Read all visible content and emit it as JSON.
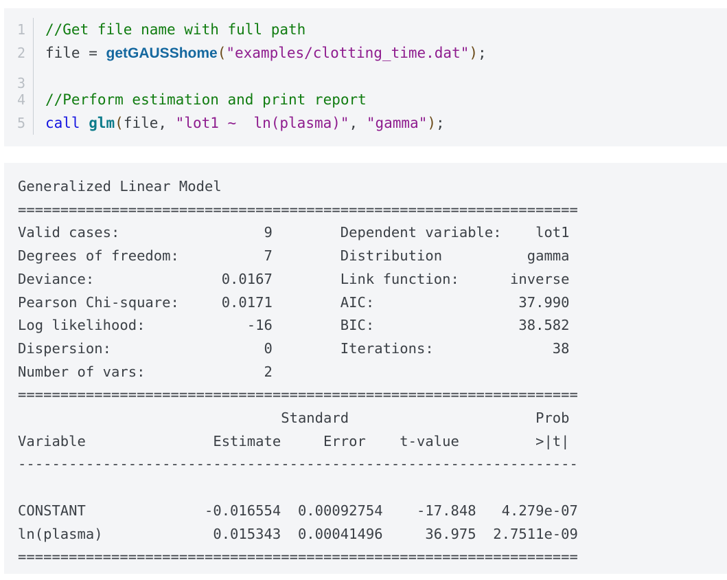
{
  "code_example": {
    "language": "GAUSS",
    "background_color": "#f4f5f7",
    "lines": [
      {
        "number": "1",
        "tokens": [
          {
            "text": "//Get file name with full path",
            "type": "comment"
          }
        ]
      },
      {
        "number": "2",
        "tokens": [
          {
            "text": "file = ",
            "type": "plain"
          },
          {
            "text": "getGAUSShome",
            "type": "fn-blue"
          },
          {
            "text": "(",
            "type": "punct"
          },
          {
            "text": "\"examples/clotting_time.dat\"",
            "type": "string"
          },
          {
            "text": ")",
            "type": "punct"
          },
          {
            "text": ";",
            "type": "plain"
          }
        ]
      },
      {
        "number": "3",
        "tokens": []
      },
      {
        "number": "4",
        "tokens": [
          {
            "text": "//Perform estimation and print report",
            "type": "comment"
          }
        ]
      },
      {
        "number": "5",
        "tokens": [
          {
            "text": "call ",
            "type": "keyword"
          },
          {
            "text": "glm",
            "type": "func-bold"
          },
          {
            "text": "(",
            "type": "punct"
          },
          {
            "text": "file, ",
            "type": "plain"
          },
          {
            "text": "\"lot1 ~  ln(plasma)\"",
            "type": "string"
          },
          {
            "text": ", ",
            "type": "plain"
          },
          {
            "text": "\"gamma\"",
            "type": "string"
          },
          {
            "text": ")",
            "type": "punct"
          },
          {
            "text": ";",
            "type": "plain"
          }
        ]
      }
    ]
  },
  "output": {
    "background_color": "#f4f5f7",
    "title": "Generalized Linear Model",
    "rule_double": "==================================================================",
    "rule_single": "------------------------------------------------------------------",
    "summary": {
      "left": [
        {
          "label": "Valid cases:",
          "value": "9"
        },
        {
          "label": "Degrees of freedom:",
          "value": "7"
        },
        {
          "label": "Deviance:",
          "value": "0.0167"
        },
        {
          "label": "Pearson Chi-square:",
          "value": "0.0171"
        },
        {
          "label": "Log likelihood:",
          "value": "-16"
        },
        {
          "label": "Dispersion:",
          "value": "0"
        },
        {
          "label": "Number of vars:",
          "value": "2"
        }
      ],
      "right": [
        {
          "label": "Dependent variable:",
          "value": "lot1"
        },
        {
          "label": "Distribution",
          "value": "gamma"
        },
        {
          "label": "Link function:",
          "value": "inverse"
        },
        {
          "label": "AIC:",
          "value": "37.990"
        },
        {
          "label": "BIC:",
          "value": "38.582"
        },
        {
          "label": "Iterations:",
          "value": "38"
        },
        {
          "label": "",
          "value": ""
        }
      ]
    },
    "summary_lines": [
      "Valid cases:                 9        Dependent variable:    lot1",
      "Degrees of freedom:          7        Distribution          gamma",
      "Deviance:               0.0167        Link function:      inverse",
      "Pearson Chi-square:     0.0171        AIC:                 37.990",
      "Log likelihood:            -16        BIC:                 38.582",
      "Dispersion:                  0        Iterations:              38",
      "Number of vars:              2"
    ],
    "coef_table": {
      "header_upper": "                               Standard                      Prob",
      "header_lower": "Variable               Estimate     Error    t-value         >|t|",
      "header_upper_cells": [
        "",
        "",
        "Standard",
        "",
        "Prob"
      ],
      "header_lower_cells": [
        "Variable",
        "Estimate",
        "Error",
        "t-value",
        ">|t|"
      ],
      "rows": [
        {
          "variable": "CONSTANT",
          "estimate": "-0.016554",
          "std_error": "0.00092754",
          "t_value": "-17.848",
          "prob": "4.279e-07",
          "line": "CONSTANT              -0.016554  0.00092754    -17.848   4.279e-07"
        },
        {
          "variable": "ln(plasma)",
          "estimate": "0.015343",
          "std_error": "0.00041496",
          "t_value": "36.975",
          "prob": "2.7511e-09",
          "line": "ln(plasma)             0.015343  0.00041496     36.975  2.7511e-09"
        }
      ]
    }
  }
}
